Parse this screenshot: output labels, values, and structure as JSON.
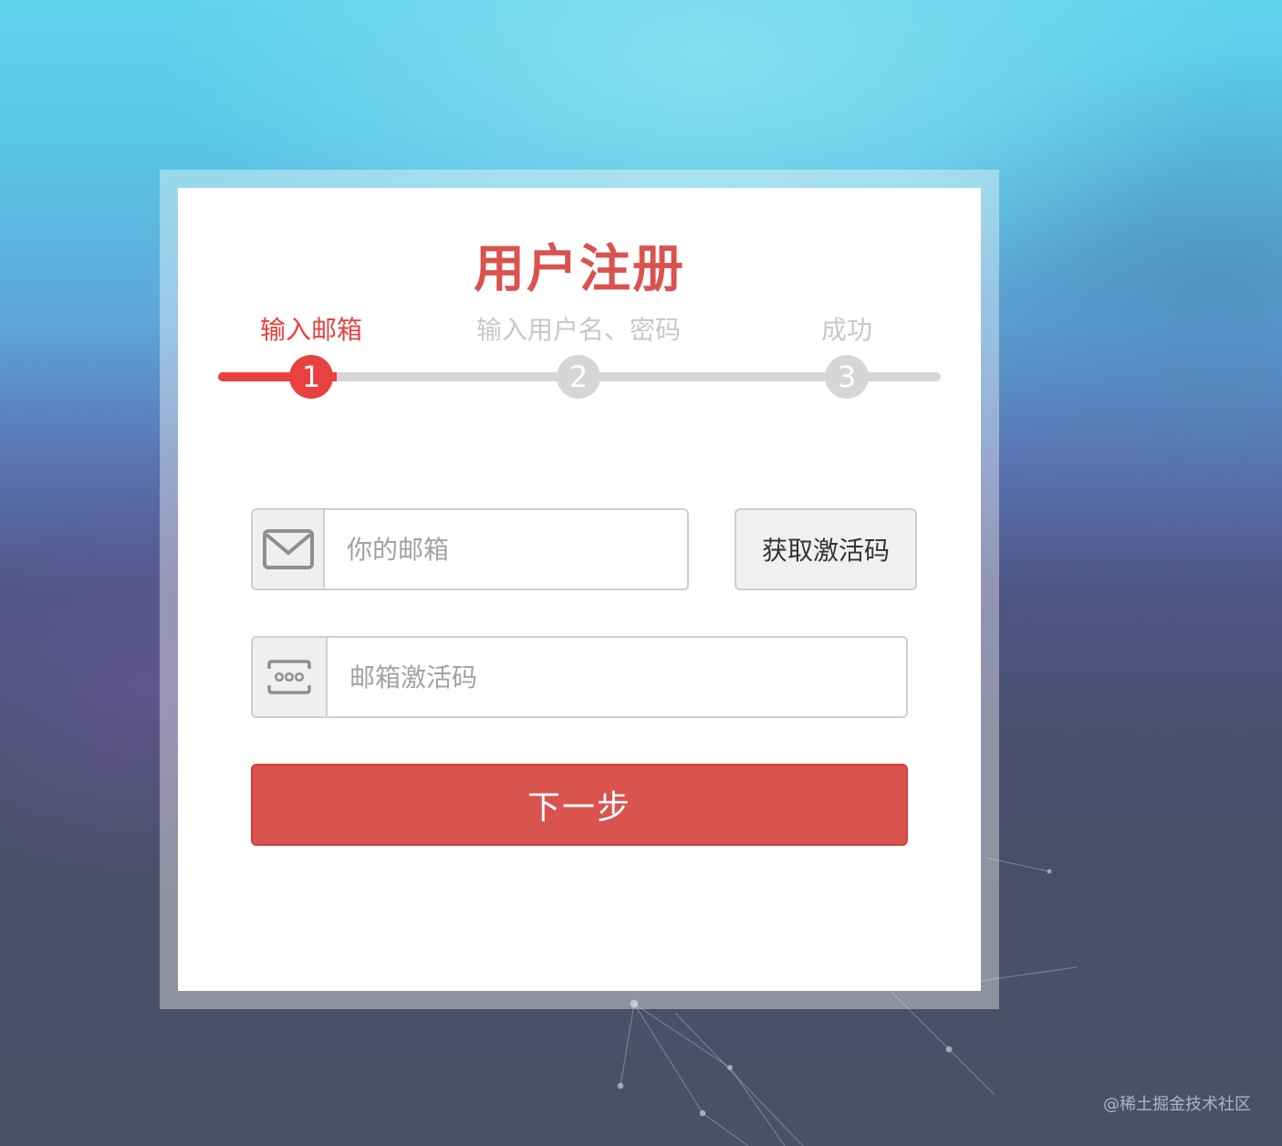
{
  "page": {
    "title": "用户注册",
    "watermark": "@稀土掘金技术社区"
  },
  "steps": [
    {
      "number": "1",
      "label": "输入邮箱",
      "active": true
    },
    {
      "number": "2",
      "label": "输入用户名、密码",
      "active": false
    },
    {
      "number": "3",
      "label": "成功",
      "active": false
    }
  ],
  "form": {
    "email": {
      "placeholder": "你的邮箱",
      "value": "",
      "icon": "envelope-icon"
    },
    "get_code_label": "获取激活码",
    "code": {
      "placeholder": "邮箱激活码",
      "value": "",
      "icon": "code-dots-icon"
    },
    "next_label": "下一步"
  },
  "colors": {
    "accent": "#d9534f",
    "step_active": "#e8413f",
    "step_inactive": "#d6d6d6"
  }
}
